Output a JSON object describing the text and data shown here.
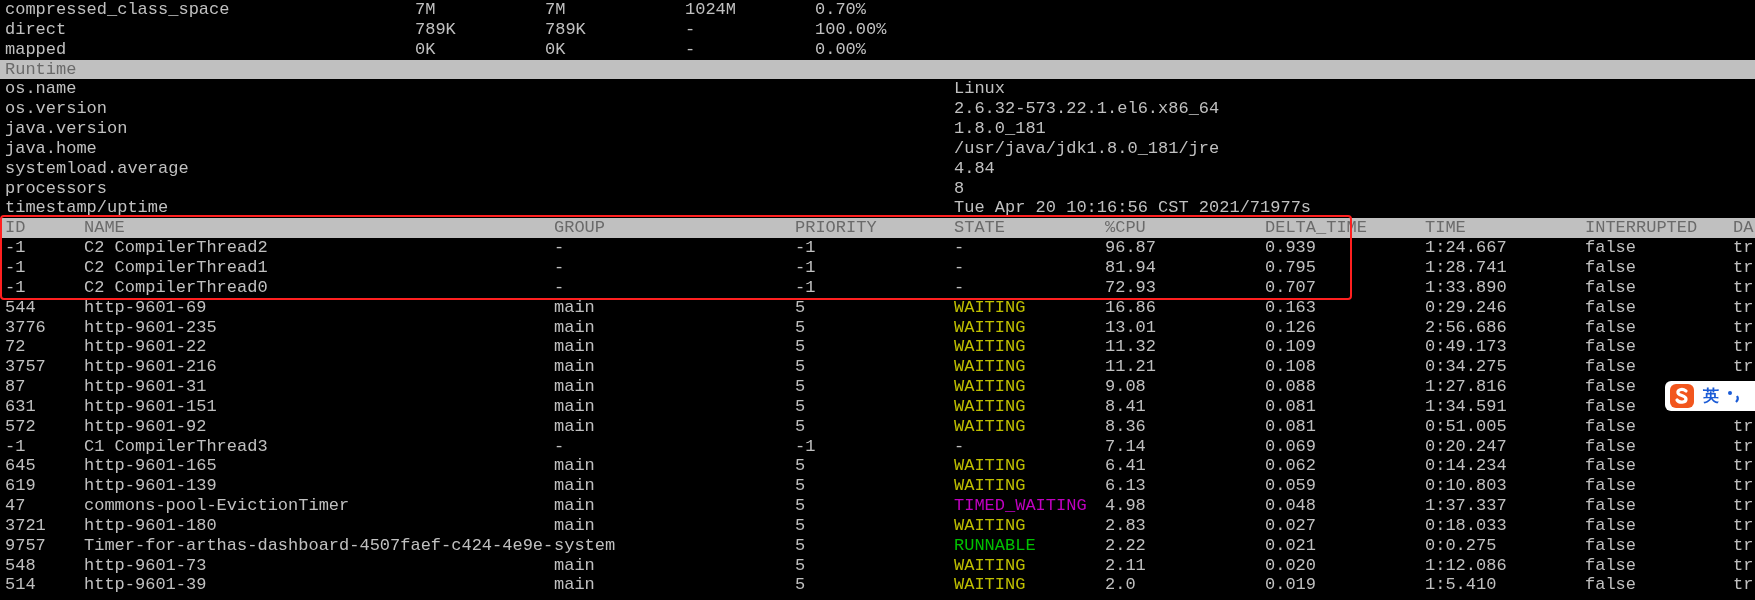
{
  "memory": {
    "rows": [
      {
        "cells": [
          "compressed_class_space",
          "7M",
          "7M",
          "1024M",
          "0.70%"
        ]
      },
      {
        "cells": [
          "direct",
          "789K",
          "789K",
          "-",
          "100.00%"
        ]
      },
      {
        "cells": [
          "mapped",
          "0K",
          "0K",
          "-",
          "0.00%"
        ]
      }
    ]
  },
  "runtime": {
    "title": "Runtime",
    "rows": [
      {
        "key": "os.name",
        "value": "Linux"
      },
      {
        "key": "os.version",
        "value": "2.6.32-573.22.1.el6.x86_64"
      },
      {
        "key": "java.version",
        "value": "1.8.0_181"
      },
      {
        "key": "java.home",
        "value": "/usr/java/jdk1.8.0_181/jre"
      },
      {
        "key": "systemload.average",
        "value": "4.84"
      },
      {
        "key": "processors",
        "value": "8"
      },
      {
        "key": "timestamp/uptime",
        "value": "Tue Apr 20 10:16:56 CST 2021/71977s"
      }
    ]
  },
  "threads": {
    "header": {
      "highlighted": true,
      "columns": [
        "ID",
        "NAME",
        "GROUP",
        "PRIORITY",
        "STATE",
        "%CPU",
        "DELTA_TIME",
        "TIME",
        "INTERRUPTED",
        "DA"
      ]
    },
    "rows": [
      {
        "highlighted": true,
        "color": "#c0c0c0",
        "cells": [
          "-1",
          "C2 CompilerThread2",
          "-",
          "-1",
          "-",
          "96.87",
          "0.939",
          "1:24.667",
          "false",
          "tr"
        ]
      },
      {
        "highlighted": true,
        "color": "#c0c0c0",
        "cells": [
          "-1",
          "C2 CompilerThread1",
          "-",
          "-1",
          "-",
          "81.94",
          "0.795",
          "1:28.741",
          "false",
          "tr"
        ]
      },
      {
        "highlighted": true,
        "color": "#c0c0c0",
        "cells": [
          "-1",
          "C2 CompilerThread0",
          "-",
          "-1",
          "-",
          "72.93",
          "0.707",
          "1:33.890",
          "false",
          "tr"
        ]
      },
      {
        "highlighted": false,
        "color": "#c0c000",
        "cells": [
          "544",
          "http-9601-69",
          "main",
          "5",
          "WAITING",
          "16.86",
          "0.163",
          "0:29.246",
          "false",
          "tr"
        ]
      },
      {
        "highlighted": false,
        "color": "#c0c000",
        "cells": [
          "3776",
          "http-9601-235",
          "main",
          "5",
          "WAITING",
          "13.01",
          "0.126",
          "2:56.686",
          "false",
          "tr"
        ]
      },
      {
        "highlighted": false,
        "color": "#c0c000",
        "cells": [
          "72",
          "http-9601-22",
          "main",
          "5",
          "WAITING",
          "11.32",
          "0.109",
          "0:49.173",
          "false",
          "tr"
        ]
      },
      {
        "highlighted": false,
        "color": "#c0c000",
        "cells": [
          "3757",
          "http-9601-216",
          "main",
          "5",
          "WAITING",
          "11.21",
          "0.108",
          "0:34.275",
          "false",
          "tr"
        ]
      },
      {
        "highlighted": false,
        "color": "#c0c000",
        "cells": [
          "87",
          "http-9601-31",
          "main",
          "5",
          "WAITING",
          "9.08",
          "0.088",
          "1:27.816",
          "false"
        ]
      },
      {
        "highlighted": false,
        "color": "#c0c000",
        "cells": [
          "631",
          "http-9601-151",
          "main",
          "5",
          "WAITING",
          "8.41",
          "0.081",
          "1:34.591",
          "false"
        ]
      },
      {
        "highlighted": false,
        "color": "#c0c000",
        "cells": [
          "572",
          "http-9601-92",
          "main",
          "5",
          "WAITING",
          "8.36",
          "0.081",
          "0:51.005",
          "false",
          "tr"
        ]
      },
      {
        "highlighted": false,
        "color": "#c0c0c0",
        "cells": [
          "-1",
          "C1 CompilerThread3",
          "-",
          "-1",
          "-",
          "7.14",
          "0.069",
          "0:20.247",
          "false",
          "tr"
        ]
      },
      {
        "highlighted": false,
        "color": "#c0c000",
        "cells": [
          "645",
          "http-9601-165",
          "main",
          "5",
          "WAITING",
          "6.41",
          "0.062",
          "0:14.234",
          "false",
          "tr"
        ]
      },
      {
        "highlighted": false,
        "color": "#c0c000",
        "cells": [
          "619",
          "http-9601-139",
          "main",
          "5",
          "WAITING",
          "6.13",
          "0.059",
          "0:10.803",
          "false",
          "tr"
        ]
      },
      {
        "highlighted": false,
        "color": "#c000c0",
        "cells": [
          "47",
          "commons-pool-EvictionTimer",
          "main",
          "5",
          "TIMED_WAITING",
          "4.98",
          "0.048",
          "1:37.337",
          "false",
          "tr"
        ]
      },
      {
        "highlighted": false,
        "color": "#c0c000",
        "cells": [
          "3721",
          "http-9601-180",
          "main",
          "5",
          "WAITING",
          "2.83",
          "0.027",
          "0:18.033",
          "false",
          "tr"
        ]
      },
      {
        "highlighted": false,
        "color": "#00c000",
        "cells": [
          "9757",
          "Timer-for-arthas-dashboard-4507faef-c424-4e9e-",
          "system",
          "5",
          "RUNNABLE",
          "2.22",
          "0.021",
          "0:0.275",
          "false",
          "tr"
        ]
      },
      {
        "highlighted": false,
        "color": "#c0c000",
        "cells": [
          "548",
          "http-9601-73",
          "main",
          "5",
          "WAITING",
          "2.11",
          "0.020",
          "1:12.086",
          "false",
          "tr"
        ]
      },
      {
        "highlighted": false,
        "color": "#c0c000",
        "cells": [
          "514",
          "http-9601-39",
          "main",
          "5",
          "WAITING",
          "2.0",
          "0.019",
          "1:5.410",
          "false",
          "tr"
        ]
      }
    ]
  },
  "ime_toolbar": {
    "mode": "英"
  }
}
